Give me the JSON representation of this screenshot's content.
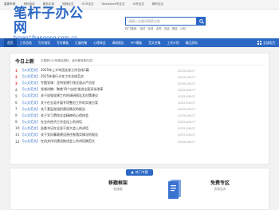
{
  "topbar": {
    "items": [
      "重要声明",
      "资料投诉",
      "著名引用",
      "知网论文",
      "OCR论文",
      "DeepSeek写论文",
      "AI写论文",
      "期刊论文"
    ]
  },
  "logo": {
    "cn": "笔杆子办公网",
    "url": "biganzibangong.com.cn"
  },
  "search": {
    "placeholder": "请输入关键词搜索文档",
    "hot_label": "热门搜索:",
    "hot": [
      "测试",
      "标准",
      "合同",
      "总结",
      "报告",
      "计划"
    ]
  },
  "nav": {
    "items": [
      "首页",
      "工作总结",
      "写作指导",
      "写作模板",
      "汇编合集",
      "心得体会",
      "调研报告",
      "PPT模板",
      "范文合集",
      "工作计划",
      "精品资料"
    ],
    "right": "全部类目"
  },
  "updates": {
    "title": "今日上新",
    "subtitle": "已更新122份精品资料，每天都有新内容!",
    "rows": [
      {
        "n": "1",
        "cat": "【公文范文】",
        "title": "2025年上半年团支部工作总结1篇",
        "date": "2025-08-07"
      },
      {
        "n": "2",
        "cat": "【公文范文】",
        "title": "2025年银行半年工作总结范文",
        "date": "2025-08-07"
      },
      {
        "n": "3",
        "cat": "【公文范文】",
        "title": "专题党课：坚持党建引领全面从严治党",
        "date": "2025-08-07"
      },
      {
        "n": "4",
        "cat": "【公文范文】",
        "title": "党课讲稿：聚焦'四个自信'推进全面深化改革",
        "date": "2025-08-07"
      },
      {
        "n": "5",
        "cat": "【公文范文】",
        "title": "关于加强党建工作的调研报告及对策建议",
        "date": "2025-08-07"
      },
      {
        "n": "6",
        "cat": "【公文范文】",
        "title": "关于在全县开展专项整治工作的实施方案",
        "date": "2025-08-07"
      },
      {
        "n": "7",
        "cat": "【公文范文】",
        "title": "关于基层党组织建设情况的报告",
        "date": "2025-08-07"
      },
      {
        "n": "8",
        "cat": "【公文范文】",
        "title": "关于学习贯彻全会精神的心得体会",
        "date": "2025-08-07"
      },
      {
        "n": "9",
        "cat": "【公文范文】",
        "title": "在全市经济工作会议上的讲话",
        "date": "2025-08-07"
      },
      {
        "n": "10",
        "cat": "【公文范文】",
        "title": "县委书记在全县干部大会上的讲话",
        "date": "2025-08-07"
      },
      {
        "n": "11",
        "cat": "【公文范文】",
        "title": "关于党风廉政建设责任制落实情况的报告",
        "date": "2025-08-07"
      },
      {
        "n": "12",
        "cat": "【公文范文】",
        "title": "在机关作风建设推进会上的讲话稿范文",
        "date": "2025-08-07"
      }
    ]
  },
  "special": {
    "tab": "热门专题",
    "cards": [
      {
        "title": "移题框架",
        "sub": "极速版"
      },
      {
        "title": "免费专区",
        "sub": "资源宝库"
      }
    ]
  },
  "colors": {
    "brand": "#2b68c4",
    "hot": "#e4393c"
  }
}
